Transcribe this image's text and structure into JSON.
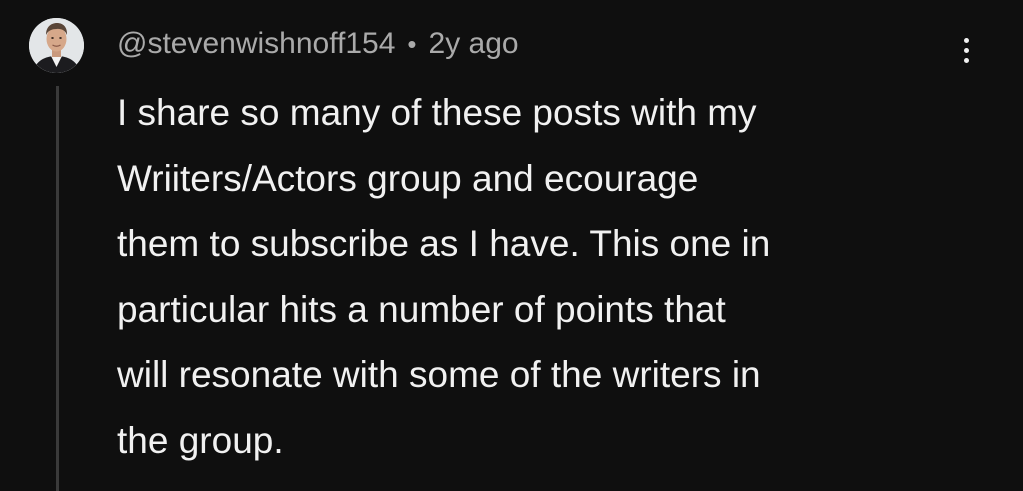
{
  "comment": {
    "author": "@stevenwishnoff154",
    "separator": "•",
    "time_ago": "2y ago",
    "more_icon": "vertical-ellipsis-icon",
    "avatar_icon": "user-avatar",
    "text_lines": [
      "I share so many of these posts with my",
      "Wriiters/Actors group and ecourage",
      "them to subscribe as I have. This one in",
      "particular hits a number of points that",
      "will resonate with some of the writers in",
      "the group."
    ]
  },
  "colors": {
    "background": "#0f0f0f",
    "primary_text": "#f1f1f1",
    "secondary_text": "#aaaaaa",
    "thread_line": "#3a3a3a"
  }
}
